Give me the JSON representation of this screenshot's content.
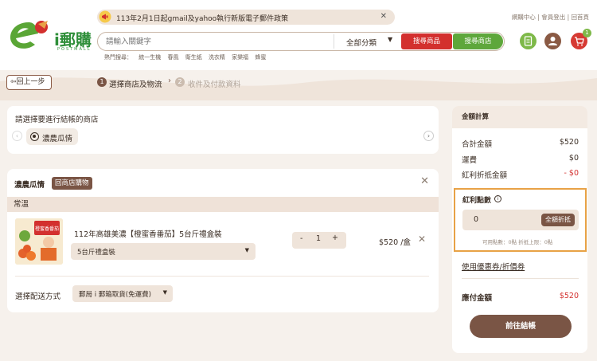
{
  "colors": {
    "brand_green": "#2f8f3a",
    "accent_brown": "#7a5545",
    "danger_red": "#d3302e",
    "highlight_orange": "#e8a246",
    "background": "#f6f1ec"
  },
  "header": {
    "logo_text": "i郵購",
    "logo_sub": "POSTMALL",
    "notice": "113年2月1日起gmail及yahoo執行新版電子郵件政策",
    "top_links": "網購中心 | 會員登出 | 回首頁",
    "search_placeholder": "請輸入關鍵字",
    "category": "全部分類",
    "search_products_btn": "搜尋商品",
    "search_shops_btn": "搜尋商店",
    "hot_label": "熱門搜尋：",
    "hot_terms": [
      "統一生機",
      "春風",
      "衛生紙",
      "洗衣精",
      "家樂福",
      "蜂蜜"
    ],
    "cart_count": "1",
    "icons": [
      "notice-megaphone-icon",
      "order-list-icon",
      "user-icon",
      "cart-icon"
    ]
  },
  "steps": {
    "back_label": "回上一步",
    "step1_num": "1",
    "step1_label": "選擇商店及物流",
    "step2_num": "2",
    "step2_label": "收件及付款資料"
  },
  "store_picker": {
    "title": "請選擇要進行結帳的商店",
    "selected_store": "濃農瓜情"
  },
  "cart": {
    "shop_name": "濃農瓜情",
    "shop_tag": "回商店購物",
    "temperature": "常溫",
    "item": {
      "image_label": "橙蜜香番茄",
      "name": "112年高雄美濃【橙蜜香番茄】5台斤禮盒裝",
      "spec": "5台斤禮盒裝",
      "quantity": "1",
      "price": "$520 /盒"
    },
    "shipping_label": "選擇配送方式",
    "shipping_method": "郵局 i 郵箱取貨(免運費)"
  },
  "summary": {
    "title": "金額計算",
    "subtotal_label": "合計金額",
    "subtotal_value": "$520",
    "shipping_label": "運費",
    "shipping_value": "$0",
    "bonus_label": "紅利折抵金額",
    "bonus_value": "- $0",
    "points_title": "紅利點數",
    "points_value": "0",
    "points_btn": "全額折抵",
    "points_note": "可用點數：0點   折抵上限：0點",
    "coupon_link": "使用優惠券/折價券",
    "total_label": "應付金額",
    "total_value": "$520",
    "checkout_btn": "前往結帳"
  }
}
